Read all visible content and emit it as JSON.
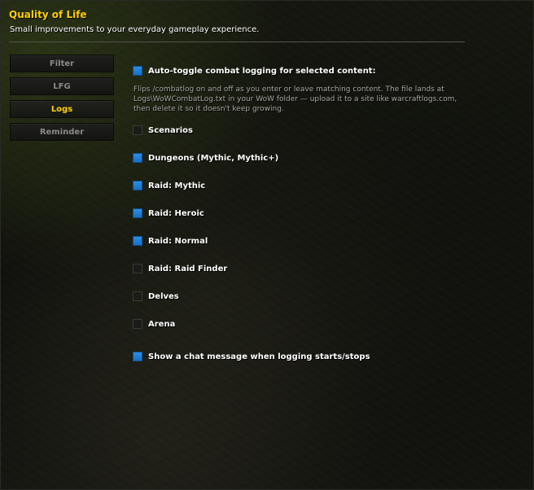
{
  "header": {
    "title": "Quality of Life",
    "subtitle": "Small improvements to your everyday gameplay experience."
  },
  "tabs": [
    {
      "label": "Filter",
      "active": false
    },
    {
      "label": "LFG",
      "active": false
    },
    {
      "label": "Logs",
      "active": true
    },
    {
      "label": "Reminder",
      "active": false
    }
  ],
  "main": {
    "auto_toggle": {
      "label": "Auto-toggle combat logging for selected content:",
      "checked": true
    },
    "description": "Flips /combatlog on and off as you enter or leave matching content. The file lands at Logs\\WoWCombatLog.txt in your WoW folder — upload it to a site like warcraftlogs.com, then delete it so it doesn't keep growing.",
    "options": [
      {
        "label": "Scenarios",
        "checked": false
      },
      {
        "label": "Dungeons (Mythic, Mythic+)",
        "checked": true
      },
      {
        "label": "Raid: Mythic",
        "checked": true
      },
      {
        "label": "Raid: Heroic",
        "checked": true
      },
      {
        "label": "Raid: Normal",
        "checked": true
      },
      {
        "label": "Raid: Raid Finder",
        "checked": false
      },
      {
        "label": "Delves",
        "checked": false
      },
      {
        "label": "Arena",
        "checked": false
      }
    ],
    "chat_message": {
      "label": "Show a chat message when logging starts/stops",
      "checked": true
    }
  },
  "colors": {
    "title": "#ffd100",
    "checkbox_on": "#1a7fd8",
    "active_tab": "#ffd100"
  }
}
